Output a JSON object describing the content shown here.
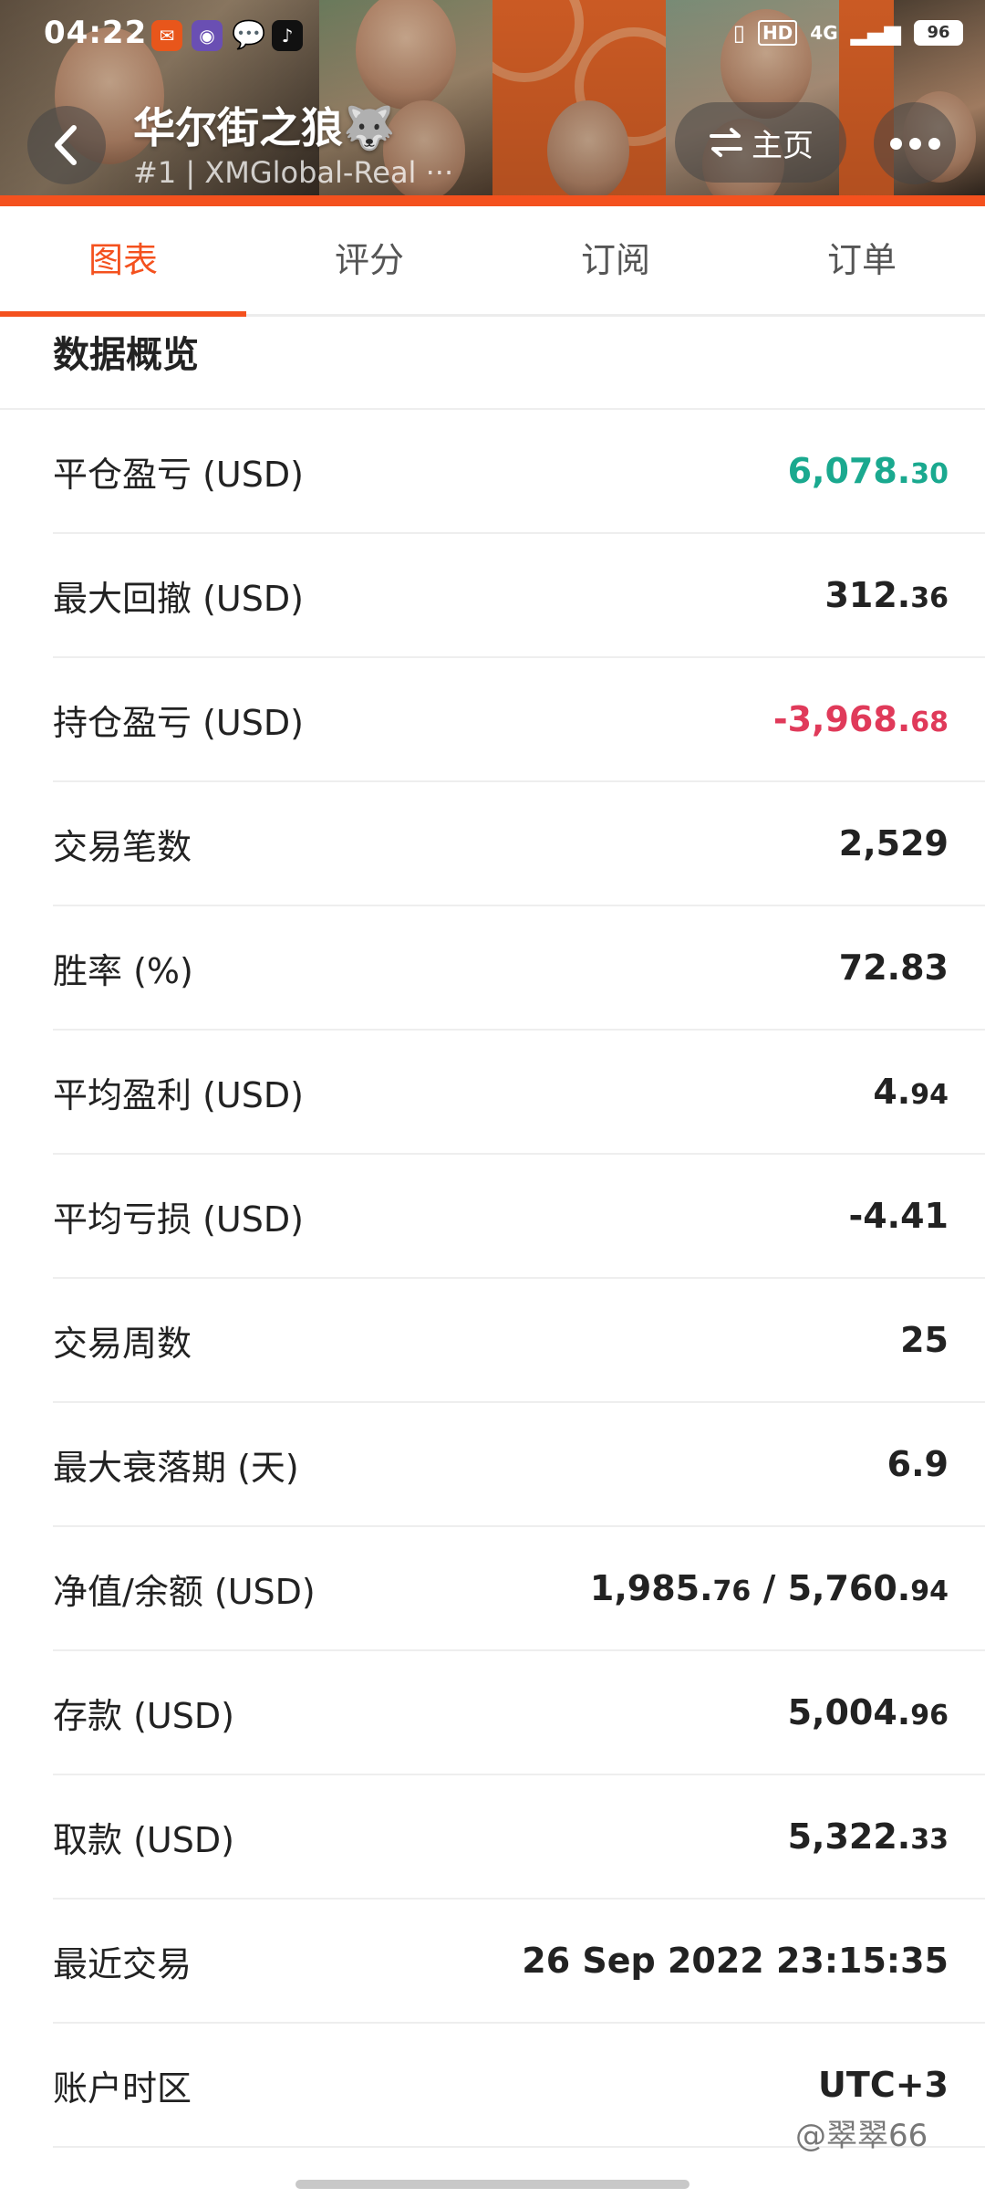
{
  "status_bar": {
    "time": "04:22",
    "battery": "96",
    "network": "4G",
    "hd": "HD"
  },
  "header": {
    "title": "华尔街之狼🐺",
    "subtitle": "#1 | XMGlobal-Real ···",
    "home_label": "主页"
  },
  "tabs": [
    {
      "label": "图表",
      "active": true
    },
    {
      "label": "评分",
      "active": false
    },
    {
      "label": "订阅",
      "active": false
    },
    {
      "label": "订单",
      "active": false
    }
  ],
  "section_title": "数据概览",
  "stats": [
    {
      "label": "平仓盈亏 (USD)",
      "int": "6,078.",
      "dec": "30",
      "color": "green"
    },
    {
      "label": "最大回撤 (USD)",
      "int": "312.",
      "dec": "36",
      "color": ""
    },
    {
      "label": "持仓盈亏 (USD)",
      "int": "-3,968.",
      "dec": "68",
      "color": "red"
    },
    {
      "label": "交易笔数",
      "int": "2,529",
      "dec": "",
      "color": ""
    },
    {
      "label": "胜率 (%)",
      "int": "72.83",
      "dec": "",
      "color": ""
    },
    {
      "label": "平均盈利 (USD)",
      "int": "4.",
      "dec": "94",
      "color": ""
    },
    {
      "label": "平均亏损 (USD)",
      "int": "-4.41",
      "dec": "",
      "color": ""
    },
    {
      "label": "交易周数",
      "int": "25",
      "dec": "",
      "color": ""
    },
    {
      "label": "最大衰落期 (天)",
      "int": "6.9",
      "dec": "",
      "color": ""
    },
    {
      "label": "净值/余额 (USD)",
      "int": "1,985.",
      "dec": "76",
      "int2": " / 5,760.",
      "dec2": "94",
      "color": ""
    },
    {
      "label": "存款 (USD)",
      "int": "5,004.",
      "dec": "96",
      "color": ""
    },
    {
      "label": "取款 (USD)",
      "int": "5,322.",
      "dec": "33",
      "color": ""
    },
    {
      "label": "最近交易",
      "int": "26 Sep 2022 23:15:35",
      "dec": "",
      "color": ""
    },
    {
      "label": "账户时区",
      "int": "UTC+3",
      "dec": "",
      "color": ""
    }
  ],
  "watermark": "@翠翠66"
}
